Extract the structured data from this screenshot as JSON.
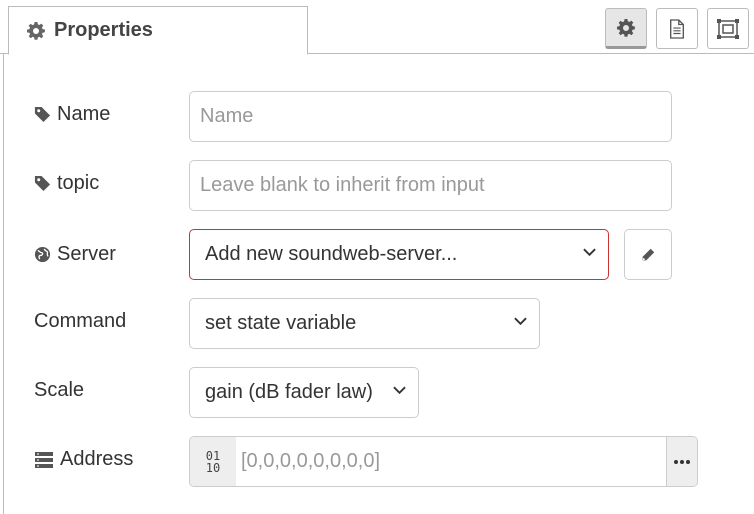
{
  "tab": {
    "label": "Properties"
  },
  "toolbar": {
    "settings_icon": "gear-icon",
    "description_icon": "file-text-icon",
    "appearance_icon": "frame-icon"
  },
  "form": {
    "name": {
      "label": "Name",
      "placeholder": "Name"
    },
    "topic": {
      "label": "topic",
      "placeholder": "Leave blank to inherit from input"
    },
    "server": {
      "label": "Server",
      "value": "Add new soundweb-server..."
    },
    "command": {
      "label": "Command",
      "value": "set state variable"
    },
    "scale": {
      "label": "Scale",
      "value": "gain (dB fader law)"
    },
    "address": {
      "label": "Address",
      "type_badge_top": "01",
      "type_badge_bottom": "10",
      "placeholder": "[0,0,0,0,0,0,0,0]"
    }
  },
  "colors": {
    "error_border": "#cc3333",
    "active_tab_bg": "#e6e6e6"
  }
}
